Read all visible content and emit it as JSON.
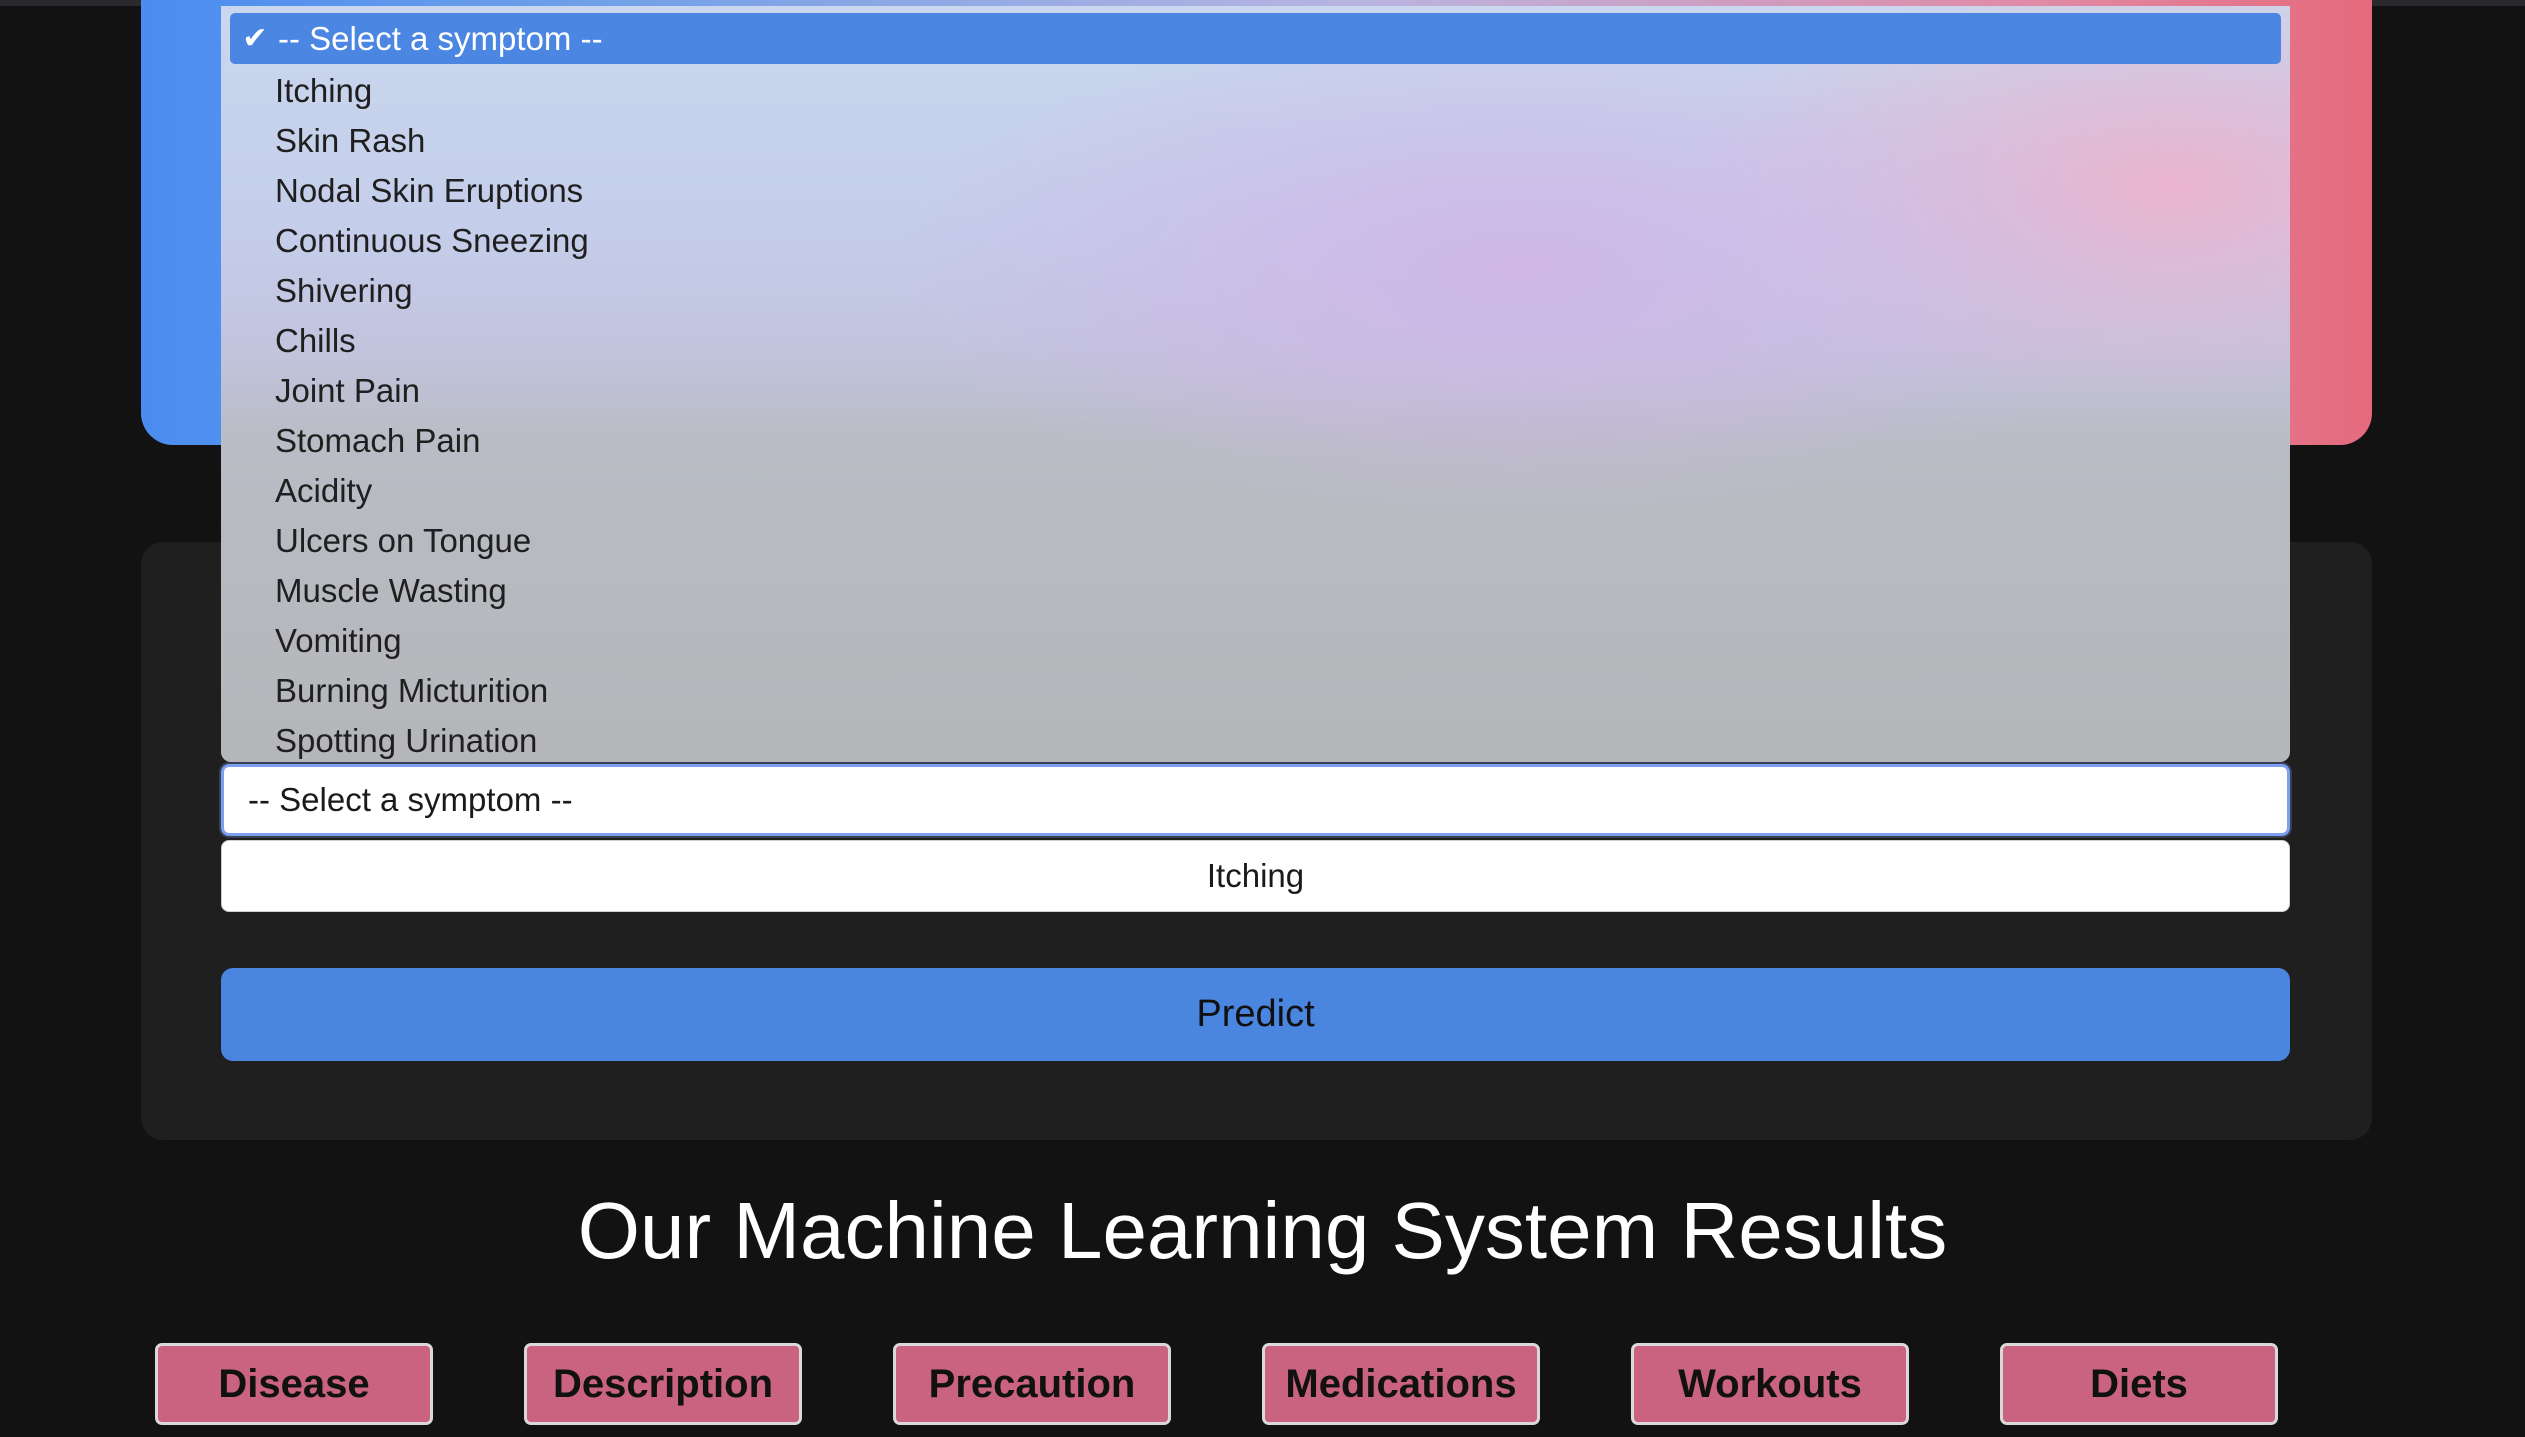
{
  "symptom_dropdown": {
    "selected_label": "-- Select a symptom --",
    "options": [
      "Itching",
      "Skin Rash",
      "Nodal Skin Eruptions",
      "Continuous Sneezing",
      "Shivering",
      "Chills",
      "Joint Pain",
      "Stomach Pain",
      "Acidity",
      "Ulcers on Tongue",
      "Muscle Wasting",
      "Vomiting",
      "Burning Micturition",
      "Spotting Urination"
    ]
  },
  "form": {
    "symptom_select_1_value": "-- Select a symptom --",
    "symptom_select_2_value": "Itching",
    "predict_label": "Predict"
  },
  "results": {
    "title": "Our Machine Learning System Results",
    "buttons": [
      "Disease",
      "Description",
      "Precaution",
      "Medications",
      "Workouts",
      "Diets"
    ]
  },
  "colors": {
    "accent_blue": "#4a86df",
    "result_button": "#c96380",
    "background": "#121212"
  },
  "icons": {
    "selected_check": "check-icon"
  }
}
